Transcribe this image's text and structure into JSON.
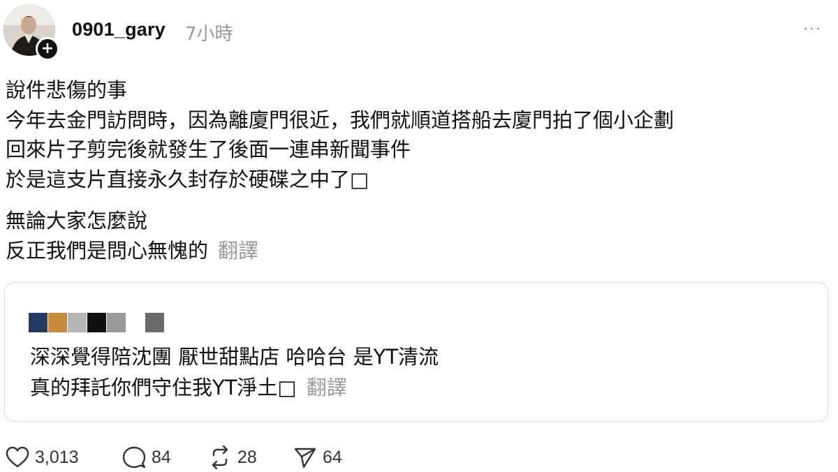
{
  "post": {
    "author": "0901_gary",
    "timestamp": "7小時",
    "more_label": "···",
    "follow_symbol": "+",
    "lines_p1": [
      "說件悲傷的事",
      "今年去金門訪問時，因為離廈門很近，我們就順道搭船去廈門拍了個小企劃",
      "回來片子剪完後就發生了後面一連串新聞事件",
      "於是這支片直接永久封存於硬碟之中了□"
    ],
    "lines_p2": [
      "無論大家怎麼說",
      "反正我們是問心無愧的"
    ],
    "translate_label": "翻譯"
  },
  "quote": {
    "redacted_colors": [
      "#233a64",
      "#c98a3c",
      "#b5b5b5",
      "#111111",
      "#999999",
      "#6b6b6b"
    ],
    "lines": [
      "深深覺得陪沈團 厭世甜點店 哈哈台 是YT清流",
      "真的拜託你們守住我YT淨土□"
    ],
    "translate_label": "翻譯"
  },
  "actions": {
    "likes": "3,013",
    "replies": "84",
    "reposts": "28",
    "shares": "64",
    "icons": [
      "heart-icon",
      "comment-icon",
      "repost-icon",
      "share-icon"
    ]
  }
}
